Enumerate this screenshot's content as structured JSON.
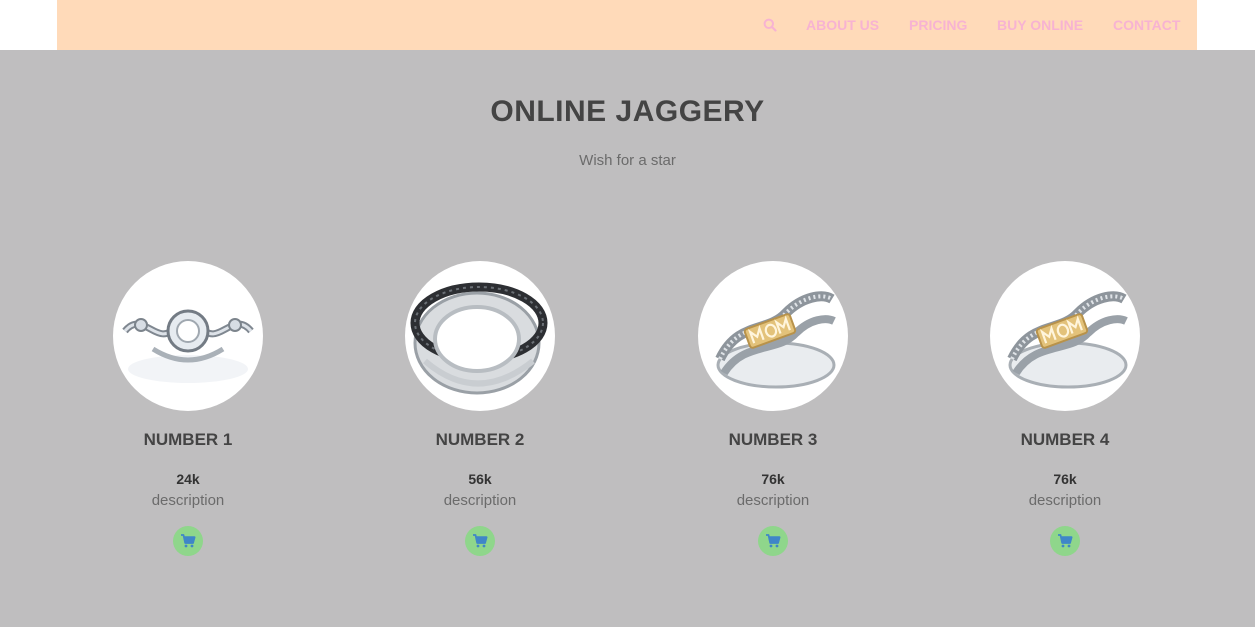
{
  "nav": {
    "search_icon": "search-icon",
    "links": [
      "ABOUT US",
      "PRICING",
      "BUY ONLINE",
      "CONTACT"
    ]
  },
  "hero": {
    "title": "ONLINE JAGGERY",
    "subtitle": "Wish for a star"
  },
  "products": [
    {
      "title": "NUMBER 1",
      "price": "24k",
      "description": "description",
      "icon": "cart-icon"
    },
    {
      "title": "NUMBER 2",
      "price": "56k",
      "description": "description",
      "icon": "cart-icon"
    },
    {
      "title": "NUMBER 3",
      "price": "76k",
      "description": "description",
      "icon": "cart-icon"
    },
    {
      "title": "NUMBER 4",
      "price": "76k",
      "description": "description",
      "icon": "cart-icon"
    }
  ],
  "colors": {
    "page_background": "#bfbebf",
    "navbar_background": "#ffdab9",
    "nav_link": "#f7b3d2",
    "cart_button": "#8fd68b",
    "cart_icon": "#3f86c8"
  }
}
